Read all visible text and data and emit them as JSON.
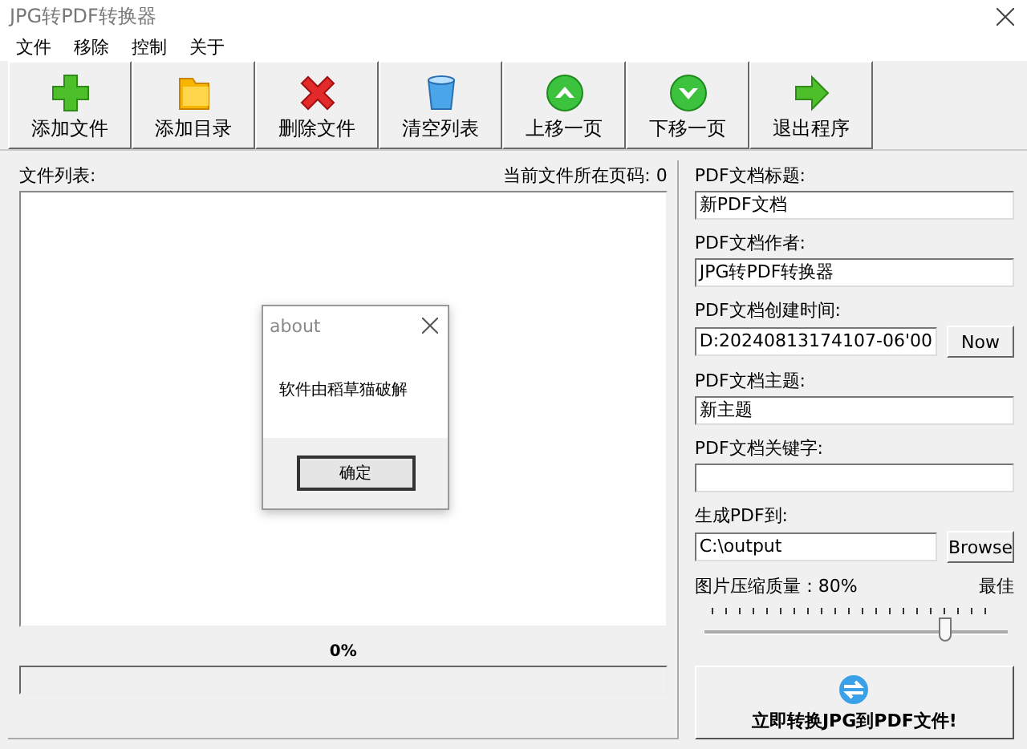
{
  "window": {
    "title": "JPG转PDF转换器"
  },
  "menu": [
    "文件",
    "移除",
    "控制",
    "关于"
  ],
  "toolbar": [
    "添加文件",
    "添加目录",
    "删除文件",
    "清空列表",
    "上移一页",
    "下移一页",
    "退出程序"
  ],
  "file_list": {
    "label": "文件列表:",
    "page_label": "当前文件所在页码: 0"
  },
  "progress": {
    "reading": "0%",
    "level": 0
  },
  "fields": [
    {
      "label": "PDF文档标题:",
      "value": "新PDF文档"
    },
    {
      "label": "PDF文档作者:",
      "value": "JPG转PDF转换器"
    },
    {
      "label": "PDF文档创建时间:",
      "value": "D:20240813174107-06'00",
      "button": "Now"
    },
    {
      "label": "PDF文档主题:",
      "value": "新主题"
    },
    {
      "label": "PDF文档关键字:"
    },
    {
      "label": "生成PDF到:",
      "value": "C:\\output",
      "button": "Browse"
    }
  ],
  "quality": {
    "label": "图片压缩质量：80%",
    "end_label": "最佳",
    "level": 0.8
  },
  "convert_button": "立即转换JPG到PDF文件!",
  "dialog": {
    "title": "about",
    "message": "软件由稻草猫破解",
    "button": "确定"
  }
}
